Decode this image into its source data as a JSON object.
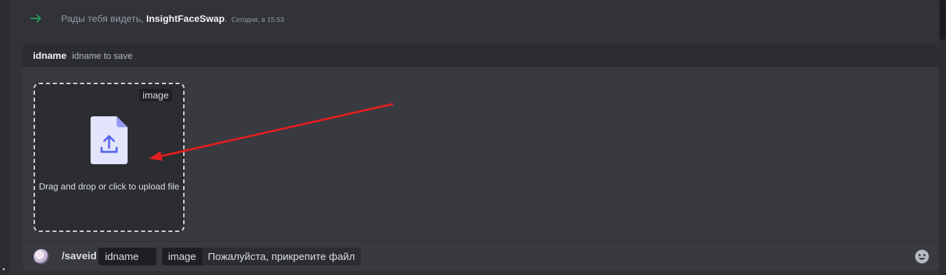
{
  "system_message": {
    "prefix": "Рады тебя видеть, ",
    "username": "InsightFaceSwap",
    "suffix": ".",
    "timestamp": "Сегодня, в 15:53",
    "icon": "arrow-right-icon",
    "icon_color": "#23a559"
  },
  "option_header": {
    "name": "idname",
    "description": "idname to save"
  },
  "upload": {
    "tag": "image",
    "instruction": "Drag and drop or click to upload file",
    "icon": "file-upload-icon",
    "accent": "#5865f2"
  },
  "command_bar": {
    "command": "/saveid",
    "options": [
      {
        "name": "idname",
        "value": ""
      },
      {
        "name": "image",
        "value": "Пожалуйста, прикрепите файл"
      }
    ],
    "emoji_icon": "emoji-icon"
  },
  "annotation": {
    "color": "#e01e1e"
  }
}
